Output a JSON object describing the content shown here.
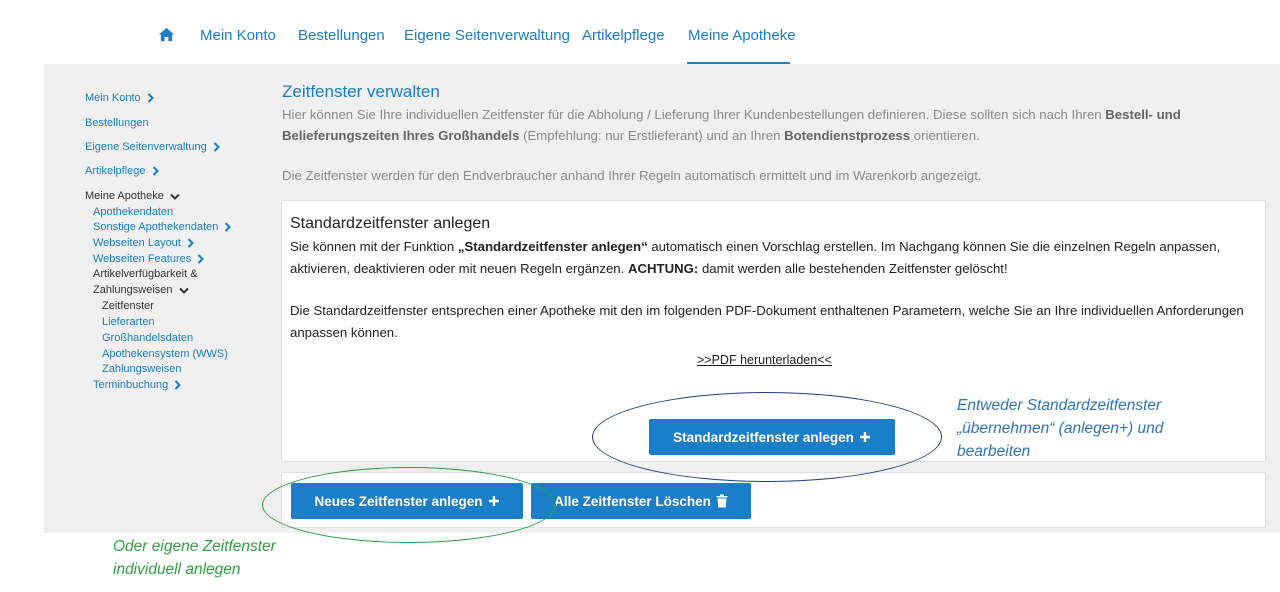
{
  "topnav": {
    "items": [
      "Mein Konto",
      "Bestellungen",
      "Eigene Seitenverwaltung",
      "Artikelpflege",
      "Meine Apotheke"
    ],
    "active": "Meine Apotheke"
  },
  "sidebar": {
    "mein_konto": "Mein Konto",
    "bestellungen": "Bestellungen",
    "seitenverwaltung": "Eigene Seitenverwaltung",
    "artikelpflege": "Artikelpflege",
    "meine_apotheke": "Meine Apotheke",
    "apothekendaten": "Apothekendaten",
    "sonstige": "Sonstige Apothekendaten",
    "layout": "Webseiten Layout",
    "features": "Webseiten Features",
    "verfuegbarkeit_1": "Artikelverfügbarkeit &",
    "verfuegbarkeit_2": "Zahlungsweisen",
    "zeitfenster": "Zeitfenster",
    "lieferarten": "Lieferarten",
    "grosshandel": "Großhandelsdaten",
    "wws": "Apothekensystem (WWS)",
    "zahlungsweisen": "Zahlungsweisen",
    "terminbuchung": "Terminbuchung"
  },
  "main": {
    "title": "Zeitfenster verwalten",
    "intro_a": "Hier können Sie Ihre individuellen Zeitfenster für die Abholung / Lieferung Ihrer Kundenbestellungen definieren. Diese sollten sich nach Ihren ",
    "intro_b": "Bestell- und Belieferungszeiten Ihres Großhandels",
    "intro_c": " (Empfehlung: nur Erstlieferant) und an Ihren ",
    "intro_d": "Botendienstprozess",
    "intro_e": " orientieren.",
    "intro2": "Die Zeitfenster werden für den Endverbraucher anhand Ihrer Regeln automatisch ermittelt und im Warenkorb angezeigt."
  },
  "card": {
    "title": "Standardzeitfenster anlegen",
    "p1_a": "Sie können mit der Funktion ",
    "p1_b": "„Standardzeitfenster anlegen“",
    "p1_c": " automatisch einen Vorschlag erstellen. Im Nachgang können Sie die einzelnen Regeln anpassen, aktivieren, deaktivieren oder mit neuen Regeln ergänzen. ",
    "p1_d": "ACHTUNG:",
    "p1_e": " damit werden alle bestehenden Zeitfenster gelöscht!",
    "p2": "Die Standardzeitfenster entsprechen einer Apotheke mit den im folgenden PDF-Dokument enthaltenen Parametern, welche Sie an Ihre individuellen Anforderungen anpassen können.",
    "pdf_link": ">>PDF herunterladen<<",
    "button": "Standardzeitfenster anlegen"
  },
  "buttons": {
    "new": "Neues Zeitfenster anlegen",
    "delete_all": "Alle Zeitfenster Löschen"
  },
  "annotations": {
    "blue_1": "Entweder Standardzeitfenster",
    "blue_2": "„übernehmen“ (anlegen+) und",
    "blue_3": "bearbeiten",
    "green_1": "Oder eigene Zeitfenster",
    "green_2": "individuell anlegen"
  },
  "colors": {
    "primary": "#1a7fc9",
    "annotation_blue": "#2e75b6",
    "annotation_green": "#2ea043",
    "panel_bg": "#f0f0f0"
  },
  "icons": [
    "home-icon",
    "chevron-right-icon",
    "chevron-down-icon",
    "plus-icon",
    "trash-icon"
  ]
}
